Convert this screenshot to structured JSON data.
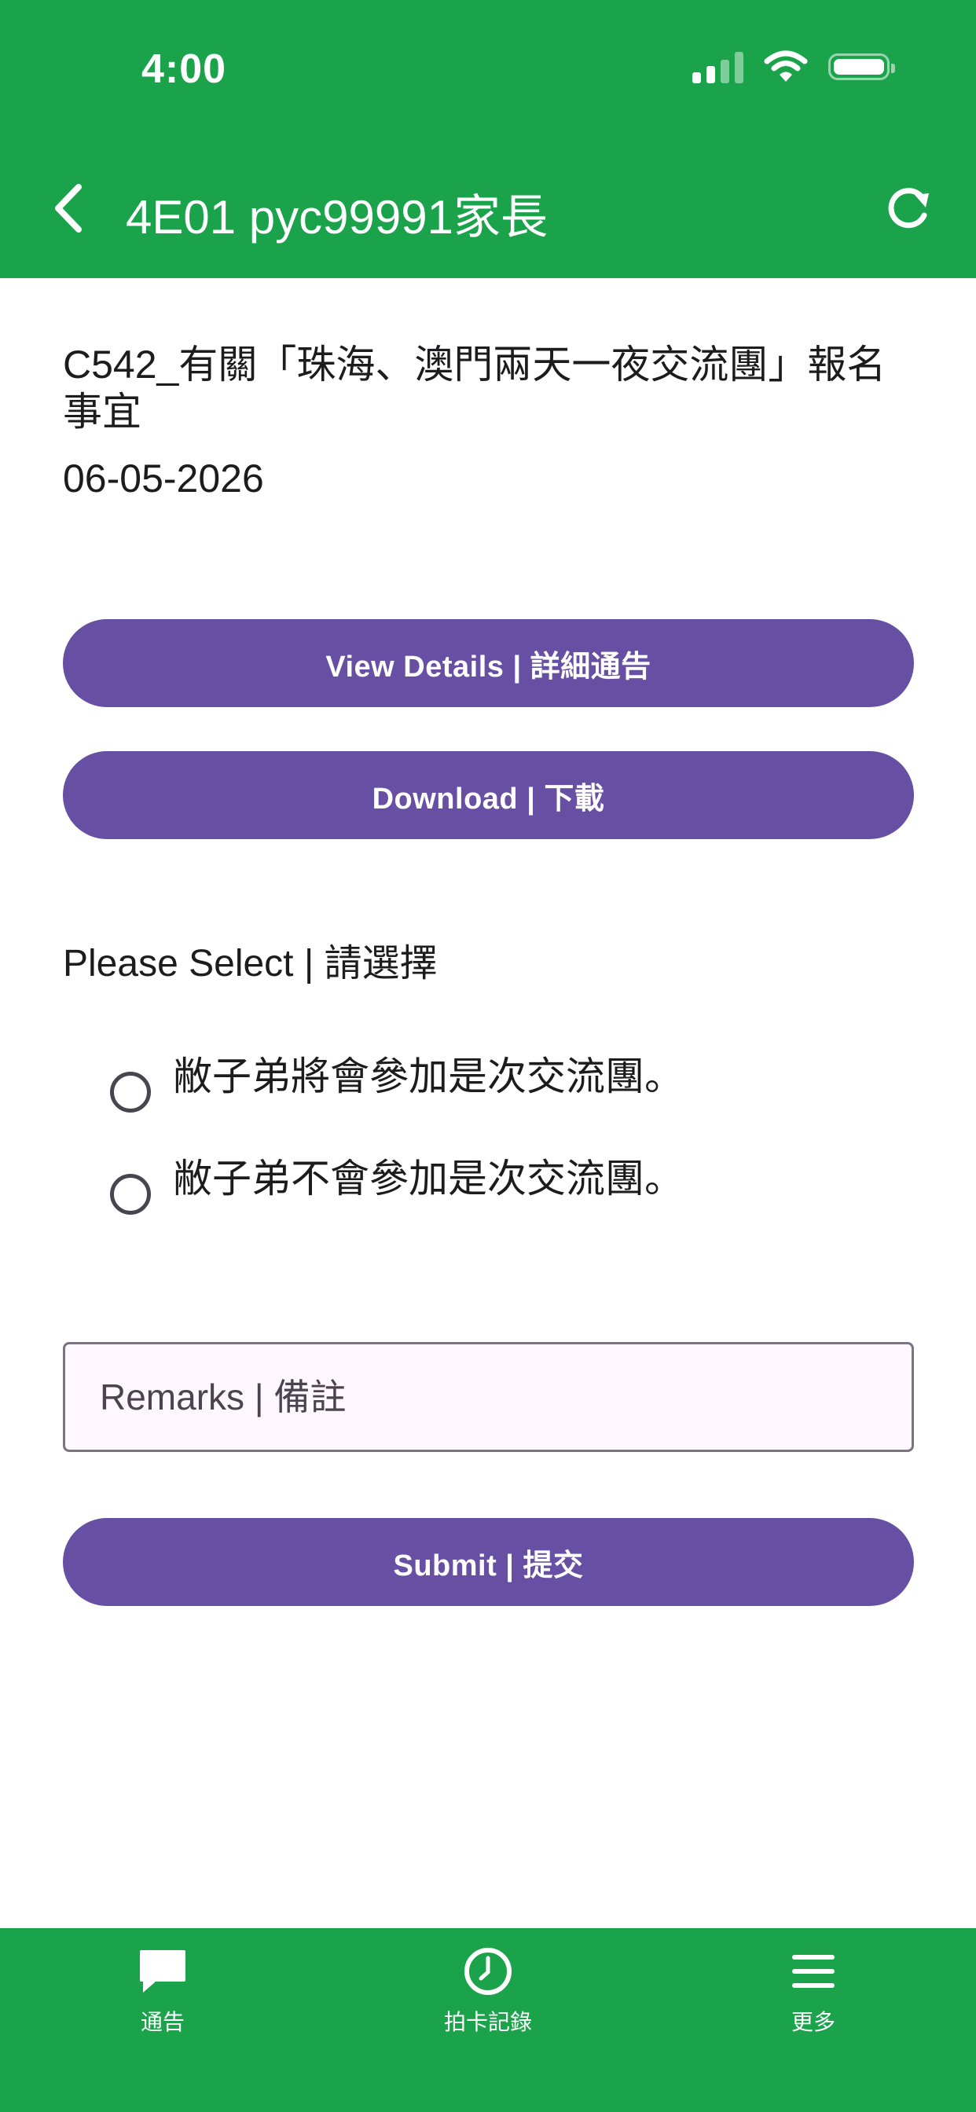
{
  "status_bar": {
    "time": "4:00"
  },
  "nav": {
    "title": "4E01 pyc99991家長"
  },
  "notice": {
    "title": "C542_有關「珠海、澳門兩天一夜交流團」報名事宜",
    "date": "06-05-2026"
  },
  "buttons": {
    "view_details": "View Details | 詳細通告",
    "download": "Download | 下載",
    "submit": "Submit | 提交"
  },
  "selection": {
    "label": "Please Select | 請選擇",
    "options": [
      {
        "label": "敝子弟將會參加是次交流團。"
      },
      {
        "label": "敝子弟不會參加是次交流團。"
      }
    ]
  },
  "remarks": {
    "placeholder": "Remarks | 備註"
  },
  "tabs": [
    {
      "label": "通告",
      "icon": "chat-bubble-icon"
    },
    {
      "label": "拍卡記錄",
      "icon": "clock-icon"
    },
    {
      "label": "更多",
      "icon": "menu-icon"
    }
  ],
  "colors": {
    "brand_green": "#1aa34a",
    "button_purple": "#6750a4"
  }
}
